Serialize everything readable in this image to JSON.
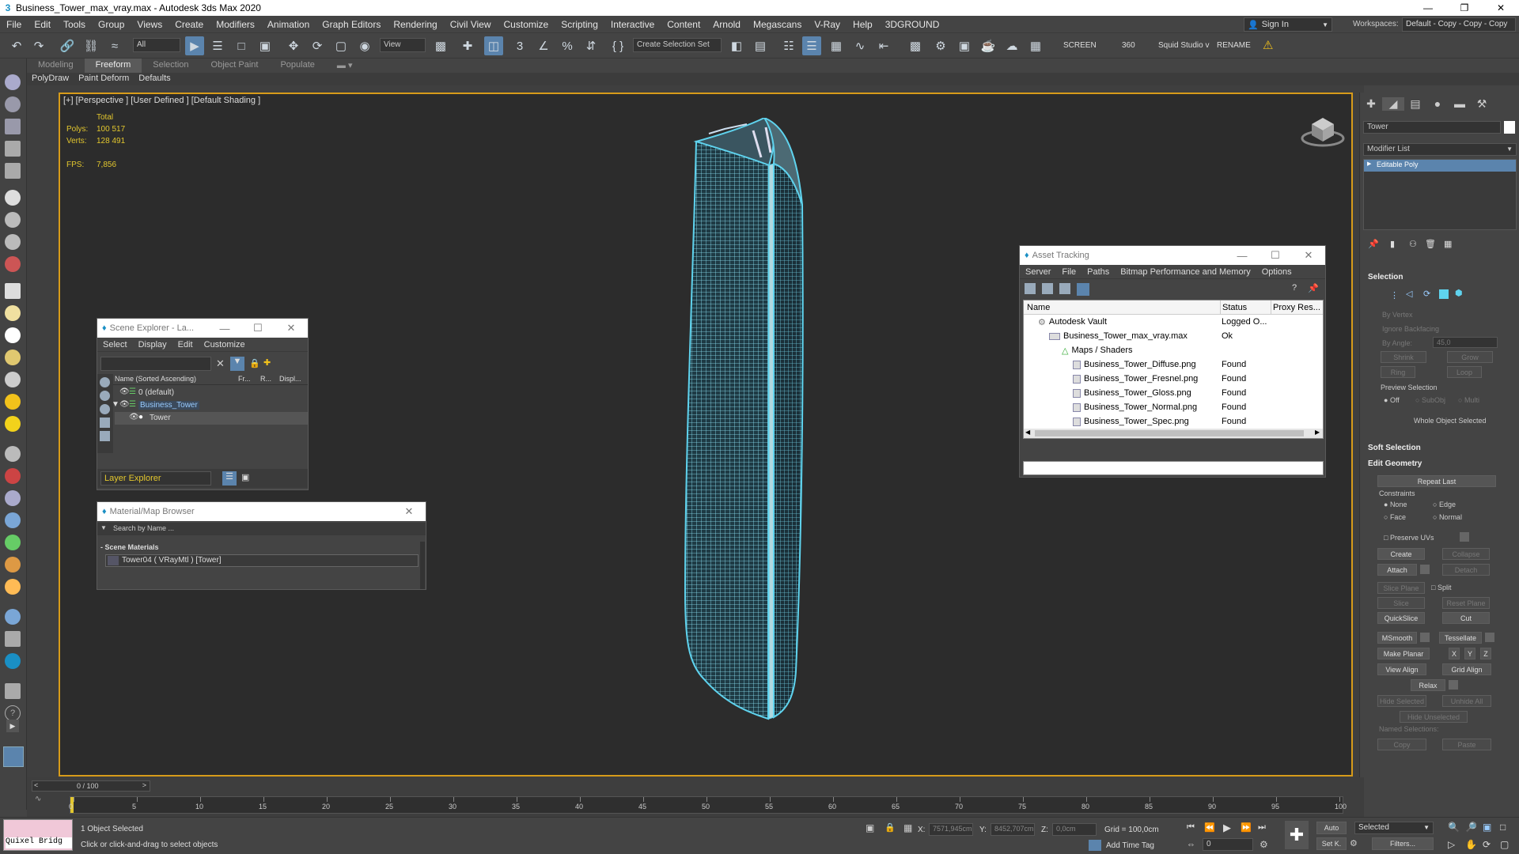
{
  "window": {
    "title": "Business_Tower_max_vray.max - Autodesk 3ds Max 2020",
    "app_icon": "3ds-max-icon"
  },
  "menu": {
    "items": [
      "File",
      "Edit",
      "Tools",
      "Group",
      "Views",
      "Create",
      "Modifiers",
      "Animation",
      "Graph Editors",
      "Rendering",
      "Civil View",
      "Customize",
      "Scripting",
      "Interactive",
      "Content",
      "Arnold",
      "Megascans",
      "V-Ray",
      "Help",
      "3DGROUND"
    ],
    "sign_in": "Sign In",
    "workspaces_label": "Workspaces:",
    "workspaces_value": "Default - Copy - Copy - Copy"
  },
  "toolbar": {
    "filter_dropdown": "All",
    "ref_coord": "View",
    "selection_set": "Create Selection Set",
    "screen_label": "SCREEN",
    "count_label": "360",
    "studio_label": "Squid Studio v",
    "rename_label": "RENAME"
  },
  "ribbon": {
    "tabs": [
      "Modeling",
      "Freeform",
      "Selection",
      "Object Paint",
      "Populate"
    ],
    "active_tab": "Freeform",
    "sub_items": [
      "PolyDraw",
      "Paint Deform",
      "Defaults"
    ]
  },
  "viewport": {
    "label": "[+] [Perspective ] [User Defined ] [Default Shading ]",
    "stats": {
      "total_label": "Total",
      "polys_label": "Polys:",
      "polys_value": "100 517",
      "verts_label": "Verts:",
      "verts_value": "128 491",
      "fps_label": "FPS:",
      "fps_value": "7,856"
    },
    "border_color": "#d79b1a",
    "wire_color": "#5fd3ee"
  },
  "scene_explorer": {
    "title": "Scene Explorer - La...",
    "menu": [
      "Select",
      "Display",
      "Edit",
      "Customize"
    ],
    "columns": [
      "Name (Sorted Ascending)",
      "Fr...",
      "R...",
      "Displ..."
    ],
    "rows": [
      {
        "name": "0 (default)"
      },
      {
        "name": "Business_Tower"
      },
      {
        "name": "Tower"
      }
    ],
    "footer_label": "Layer Explorer"
  },
  "material_browser": {
    "title": "Material/Map Browser",
    "search_placeholder": "Search by Name ...",
    "section": "- Scene Materials",
    "item": "Tower04  ( VRayMtl )  [Tower]"
  },
  "asset_tracking": {
    "title": "Asset Tracking",
    "menu": [
      "Server",
      "File",
      "Paths",
      "Bitmap Performance and Memory",
      "Options"
    ],
    "columns": [
      "Name",
      "Status",
      "Proxy Res..."
    ],
    "rows": [
      {
        "name": "Autodesk Vault",
        "status": "Logged O..."
      },
      {
        "name": "Business_Tower_max_vray.max",
        "status": "Ok"
      },
      {
        "name": "Maps / Shaders",
        "status": ""
      },
      {
        "name": "Business_Tower_Diffuse.png",
        "status": "Found"
      },
      {
        "name": "Business_Tower_Fresnel.png",
        "status": "Found"
      },
      {
        "name": "Business_Tower_Gloss.png",
        "status": "Found"
      },
      {
        "name": "Business_Tower_Normal.png",
        "status": "Found"
      },
      {
        "name": "Business_Tower_Spec.png",
        "status": "Found"
      }
    ]
  },
  "command_panel": {
    "object_name": "Tower",
    "modifier_list": "Modifier List",
    "modifier_item": "Editable Poly",
    "selection_head": "Selection",
    "by_vertex": "By Vertex",
    "ignore_backfacing": "Ignore Backfacing",
    "by_angle": "By Angle:",
    "angle_value": "45,0",
    "shrink": "Shrink",
    "grow": "Grow",
    "ring": "Ring",
    "loop": "Loop",
    "preview_selection": "Preview Selection",
    "off": "Off",
    "subobj": "SubObj",
    "multi": "Multi",
    "whole_object": "Whole Object Selected",
    "soft_selection": "Soft Selection",
    "edit_geometry": "Edit Geometry",
    "repeat_last": "Repeat Last",
    "constraints": "Constraints",
    "none": "None",
    "edge": "Edge",
    "face": "Face",
    "normal": "Normal",
    "preserve_uvs": "Preserve UVs",
    "create": "Create",
    "collapse": "Collapse",
    "attach": "Attach",
    "detach": "Detach",
    "slice_plane": "Slice Plane",
    "split": "Split",
    "slice": "Slice",
    "reset_plane": "Reset Plane",
    "quickslice": "QuickSlice",
    "cut": "Cut",
    "msmooth": "MSmooth",
    "tessellate": "Tessellate",
    "make_planar": "Make Planar",
    "x": "X",
    "y": "Y",
    "z": "Z",
    "view_align": "View Align",
    "grid_align": "Grid Align",
    "relax": "Relax",
    "hide_selected": "Hide Selected",
    "unhide_all": "Unhide All",
    "hide_unselected": "Hide Unselected",
    "named_selections": "Named Selections:",
    "copy": "Copy",
    "paste": "Paste"
  },
  "timeline": {
    "frame_counter": "0 / 100",
    "ticks": [
      "0",
      "5",
      "10",
      "15",
      "20",
      "25",
      "30",
      "35",
      "40",
      "45",
      "50",
      "55",
      "60",
      "65",
      "70",
      "75",
      "80",
      "85",
      "90",
      "95",
      "100"
    ]
  },
  "status": {
    "maxscript_label": "Quixel Bridg",
    "selected_count": "1 Object Selected",
    "prompt": "Click or click-and-drag to select objects",
    "x_label": "X:",
    "x_value": "7571,945cm",
    "y_label": "Y:",
    "y_value": "8452,707cm",
    "z_label": "Z:",
    "z_value": "0,0cm",
    "grid": "Grid = 100,0cm",
    "add_time_tag": "Add Time Tag",
    "auto": "Auto",
    "set_key": "Set K.",
    "key_filter": "Selected",
    "filters": "Filters...",
    "frame_value": "0"
  }
}
